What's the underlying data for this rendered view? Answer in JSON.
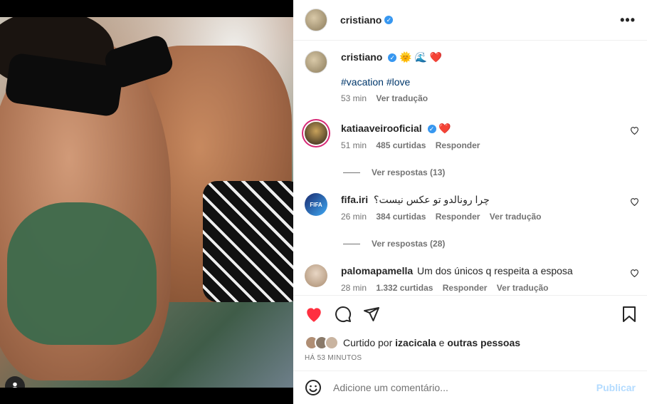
{
  "post": {
    "author": "cristiano",
    "more_label": "•••"
  },
  "caption": {
    "author": "cristiano",
    "emojis": "🌞 🌊 ❤️",
    "tags": "#vacation #love",
    "time": "53 min",
    "translate": "Ver tradução"
  },
  "comments": [
    {
      "author": "katiaaveirooficial",
      "text": "❤️",
      "time": "51 min",
      "likes": "485 curtidas",
      "reply": "Responder",
      "translate": "",
      "view_replies": "Ver respostas (13)"
    },
    {
      "author": "fifa.iri",
      "text": "چرا رونالدو تو عکس نیست؟",
      "time": "26 min",
      "likes": "384 curtidas",
      "reply": "Responder",
      "translate": "Ver tradução",
      "view_replies": "Ver respostas (28)"
    },
    {
      "author": "palomapamella",
      "text": "Um dos únicos q respeita a esposa",
      "time": "28 min",
      "likes": "1.332 curtidas",
      "reply": "Responder",
      "translate": "Ver tradução"
    }
  ],
  "likes": {
    "prefix": "Curtido por",
    "user": "izacicala",
    "mid": "e",
    "others": "outras pessoas"
  },
  "timestamp": "HÁ 53 MINUTOS",
  "add_comment": {
    "placeholder": "Adicione um comentário...",
    "publish": "Publicar"
  },
  "colors": {
    "heart": "#ff3040",
    "verified": "#3797f0",
    "link": "#00376b",
    "publish_disabled": "#b3dbff"
  },
  "icons": [
    "verified-icon",
    "more-icon",
    "heart-icon",
    "comment-icon",
    "share-icon",
    "bookmark-icon",
    "emoji-icon",
    "user-tag-icon"
  ]
}
